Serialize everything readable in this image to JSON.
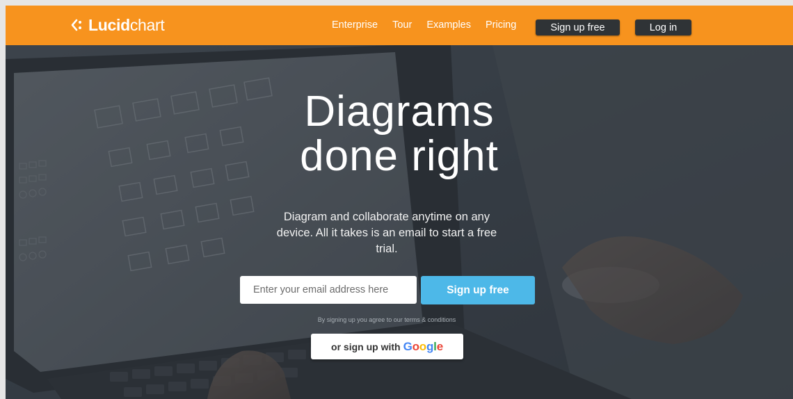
{
  "header": {
    "logo_bold": "Lucid",
    "logo_light": "chart",
    "nav": [
      "Enterprise",
      "Tour",
      "Examples",
      "Pricing"
    ],
    "signup_label": "Sign up free",
    "login_label": "Log in",
    "brand_color": "#f7931e",
    "dark_button_color": "#2f3336"
  },
  "hero": {
    "title_line1": "Diagrams",
    "title_line2": "done right",
    "subtitle": "Diagram and collaborate anytime on any device. All it takes is an email to start a free trial.",
    "email_placeholder": "Enter your email address here",
    "signup_label": "Sign up free",
    "signup_color": "#4db8e8",
    "terms": "By signing up you agree to our terms & conditions",
    "google_prefix": "or sign up with",
    "google_word": [
      "G",
      "o",
      "o",
      "g",
      "l",
      "e"
    ],
    "google_colors": [
      "#4285f4",
      "#ea4335",
      "#fbbc05",
      "#4285f4",
      "#34a853",
      "#ea4335"
    ],
    "background_icon": "laptop-with-diagram-photo"
  }
}
